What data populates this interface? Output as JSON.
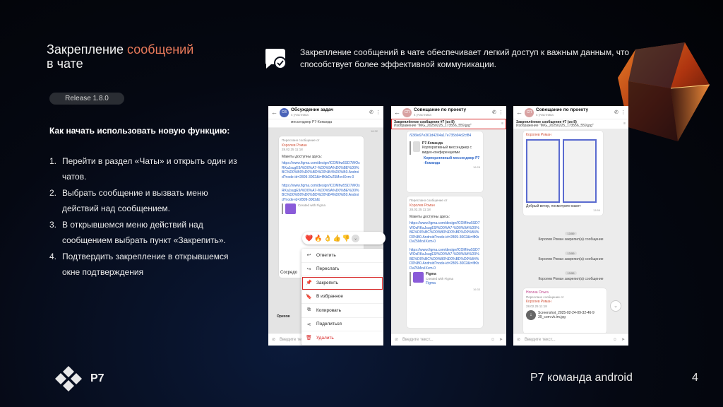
{
  "title": {
    "part1": "Закрепление ",
    "accent": "сообщений",
    "part2": "в чате"
  },
  "release": "Release 1.8.0",
  "howto_heading": "Как начать использовать новую функцию:",
  "steps": [
    {
      "num": "1.",
      "text": "Перейти в раздел «Чаты» и открыть один из чатов."
    },
    {
      "num": "2.",
      "text": "Выбрать сообщение и вызвать меню действий над сообщением."
    },
    {
      "num": "3.",
      "text": "В открывшемся меню действий над сообщением выбрать пункт «Закрепить»."
    },
    {
      "num": "4.",
      "text": "Подтвердить закрепление в открывшемся окне подтверждения"
    }
  ],
  "description": "Закрепление сообщений в чате обеспечивает легкий доступ к важным данным, что способствует более эффективной коммуникации.",
  "screen1": {
    "avatar": "ОЗ",
    "chat_name": "Обсуждение задач",
    "members": "4 участника",
    "pinned_snippet": "мессенджер Р7-Команда",
    "time1": "16:32",
    "fwd": "Переслано сообщение от",
    "author": "Королев Роман",
    "date": "28.02.25 11:18",
    "msg": "Макеты доступны здесь:",
    "link": "https://www.figma.com/design/ICOMhw5SD7WOsRKaJsugE9/%D0%A7-%D0%9A%D0%BE%D0%BC%D0%B0%D0%BD%D0%B4%D0%B0.Android?node-id=2809-3002&t=lfKbDvZ5MxvIXvm-0",
    "link2": "https://www.figma.com/design/ICOMhw5SD7WOsRKaJsugE9/%D0%A7-%D0%9A%D0%BE%D0%BC%D0%B0%D0%BD%D0%B4%D0%B0.Android?node-id=2809-3002&t",
    "figma_caption": "Created with Figma",
    "sosredo": "Сосредо",
    "orekh": "Орехов",
    "reactions": [
      "❤️",
      "🔥",
      "👌",
      "👍",
      "👎"
    ],
    "menu": [
      {
        "icon": "↩",
        "label": "Ответить"
      },
      {
        "icon": "↪",
        "label": "Переслать"
      },
      {
        "icon": "📌",
        "label": "Закрепить"
      },
      {
        "icon": "🔖",
        "label": "В избранное"
      },
      {
        "icon": "⧉",
        "label": "Копировать"
      },
      {
        "icon": "⋖",
        "label": "Поделиться"
      },
      {
        "icon": "🗑",
        "label": "Удалить"
      }
    ],
    "input_placeholder": "Введите текст..."
  },
  "screen2": {
    "avatar": "СП",
    "chat_name": "Совещание по проекту",
    "members": "4 участника",
    "pinned_title": "Закреплённое сообщение #7 (из 8)",
    "pinned_text": "Изображение \"IMG_20250225_173556_559.jpg\"",
    "link_top": "/936fe97e361d4204a17e735b94d2cf84",
    "card_title": "Р7-Команда",
    "card_desc": "Корпоративный мессенджер с видео-конференциями",
    "card_link": "Корпоративный мессенджер Р7-Команда",
    "time1": "16:28",
    "fwd": "Переслано сообщение от",
    "author": "Королев Роман",
    "date": "28.02.25 11:18",
    "msg": "Макеты доступны здесь:",
    "link": "https://www.figma.com/design/ICOMhw5SD7WOsRKaJsugE9/%D0%A7-%D0%9A%D0%BE%D0%BC%D0%B0%D0%BD%D0%B4%D0%B0.Android?node-id=2809-3002&t=lfKbDvZ5MxvIXvm-0",
    "link2": "https://www.figma.com/design/ICOMhw5SD7WOsRKaJsugE9/%D0%A7-%D0%9A%D0%BE%D0%BC%D0%B0%D0%BD%D0%B4%D0%B0.Android?node-id=2809-3002&t=lfKbDvZ5MxvIXvm-0",
    "figma_title": "Figma",
    "figma_caption": "Created with Figma",
    "figma_link": "Figma",
    "time2": "16:33",
    "input_placeholder": "Введите текст..."
  },
  "screen3": {
    "avatar": "СП",
    "chat_name": "Совещание по проекту",
    "members": "4 участника",
    "pinned_title": "Закреплённое сообщение #7 (из 8)",
    "pinned_text": "Изображение \"IMG_20250225_173556_559.jpg\"",
    "author_top": "Королев Роман",
    "greeting": "Добрый вечер, посмотрите макет",
    "time1": "13:59",
    "events": [
      {
        "time": "13:59",
        "text": "Королев Роман закрепил(а) сообщение"
      },
      {
        "time": "13:59",
        "text": "Королев Роман закрепил(а) сообщение"
      },
      {
        "time": "13:59",
        "text": "Королев Роман закрепил(а) сообщение"
      }
    ],
    "sender": "Ногина Ольга",
    "fwd": "Переслано сообщение от",
    "author": "Королев Роман",
    "date": "28.02.25 11:18",
    "file_name": "Screenshot_2025-02-24-09-32-46-939_com.vk.im.jpg",
    "input_placeholder": "Введите текст..."
  },
  "logo_text": "P7",
  "footer": "Р7 команда android",
  "page_number": "4",
  "colors": {
    "accent": "#e97a5a",
    "highlight": "#d82828",
    "link": "#2a63c6"
  }
}
